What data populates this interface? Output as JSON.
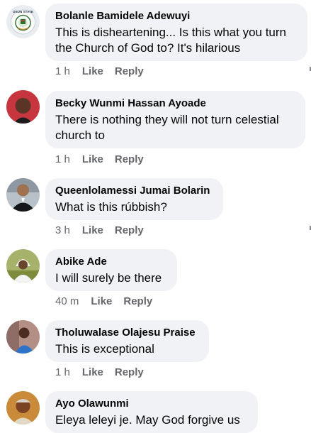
{
  "comments": [
    {
      "author": "Bolanle Bamidele Adewuyi",
      "text": "This is disheartening... Is this what you turn the Church of God to? It's hilarious",
      "time": "1 h",
      "like": "Like",
      "reply": "Reply",
      "avatar_icon": "osun-state-seal-icon",
      "avatar_text": "OSUN STATE"
    },
    {
      "author": "Becky Wunmi Hassan Ayoade",
      "text": "There is nothing they will not turn celestial church to",
      "time": "1 h",
      "like": "Like",
      "reply": "Reply",
      "avatar_icon": "user-photo-icon"
    },
    {
      "author": "Queenlolamessi Jumai Bolarin",
      "text": "What is this rúbbish?",
      "time": "3 h",
      "like": "Like",
      "reply": "Reply",
      "avatar_icon": "user-photo-icon"
    },
    {
      "author": "Abike Ade",
      "text": "I will surely be there",
      "time": "40 m",
      "like": "Like",
      "reply": "Reply",
      "avatar_icon": "user-photo-icon"
    },
    {
      "author": "Tholuwalase Olajesu Praise",
      "text": "This is exceptional",
      "time": "1 h",
      "like": "Like",
      "reply": "Reply",
      "avatar_icon": "user-photo-icon"
    },
    {
      "author": "Ayo Olawunmi",
      "text": "Eleya leleyi je. May God forgive us",
      "avatar_icon": "user-photo-icon"
    }
  ],
  "colors": {
    "bubble": "#f0f2f5",
    "text": "#050505",
    "meta": "#65676b"
  }
}
